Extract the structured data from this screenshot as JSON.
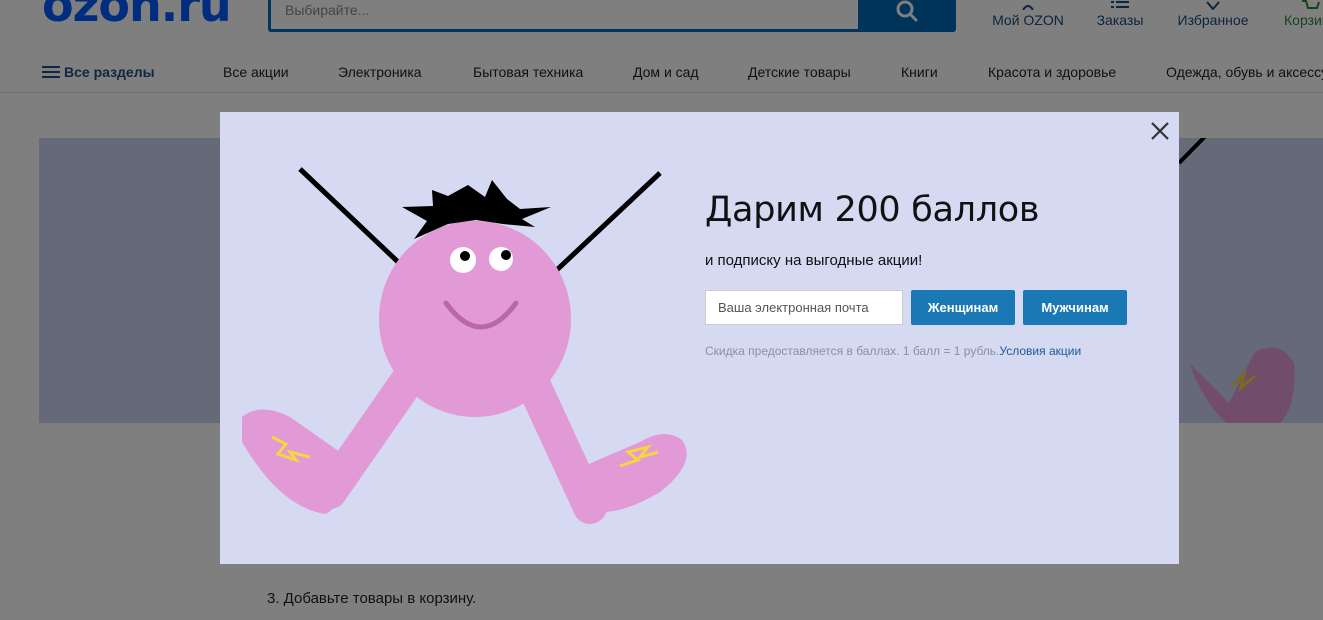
{
  "header": {
    "logo": "ozon.ru",
    "search_placeholder": "Выбирайте...",
    "links": [
      {
        "label": "Мой OZON",
        "icon": "user-icon"
      },
      {
        "label": "Заказы",
        "icon": "list-icon"
      },
      {
        "label": "Избранное",
        "icon": "heart-icon"
      },
      {
        "label": "Корзина",
        "icon": "cart-icon"
      }
    ]
  },
  "nav": {
    "all_sections": "Все разделы",
    "items": [
      "Все акции",
      "Электроника",
      "Бытовая техника",
      "Дом и сад",
      "Детские товары",
      "Книги",
      "Красота и здоровье",
      "Одежда, обувь и аксессуары"
    ]
  },
  "page": {
    "step3": "3. Добавьте товары в корзину."
  },
  "modal": {
    "title": "Дарим 200 баллов",
    "subtitle": "и подписку на выгодные акции!",
    "email_placeholder": "Ваша электронная почта",
    "women_button": "Женщинам",
    "men_button": "Мужчинам",
    "disclaimer": "Скидка предоставляется в баллах. 1 балл = 1 рубль.",
    "terms_link": "Условия акции"
  },
  "colors": {
    "brand": "#005bff",
    "button": "#1a78b4",
    "modal_bg": "#d5d9f2",
    "character": "#e29ad6"
  }
}
